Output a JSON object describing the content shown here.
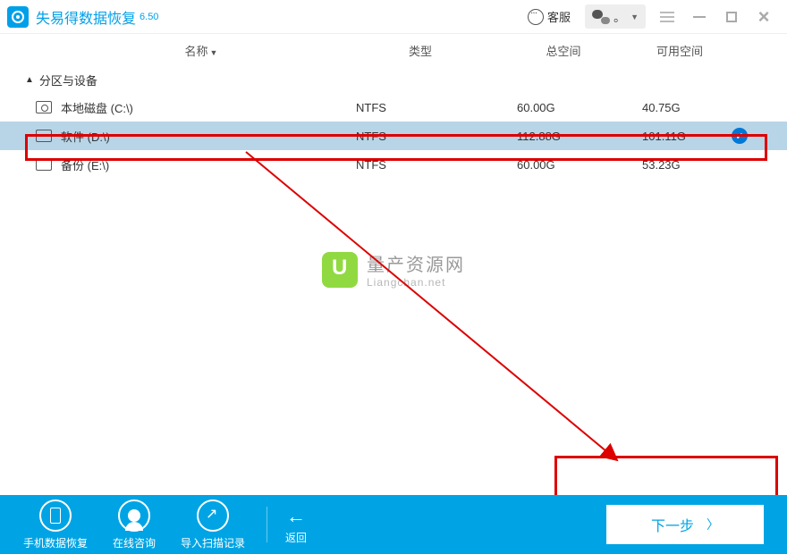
{
  "app": {
    "title": "失易得数据恢复",
    "version": "6.50"
  },
  "titlebar": {
    "kefu": "客服",
    "wechat_dot": "。"
  },
  "columns": {
    "name": "名称",
    "type": "类型",
    "total": "总空间",
    "available": "可用空间"
  },
  "section": {
    "label": "分区与设备"
  },
  "drives": [
    {
      "name": "本地磁盘 (C:\\)",
      "type": "NTFS",
      "total": "60.00G",
      "available": "40.75G",
      "selected": false,
      "icon": "disk"
    },
    {
      "name": "软件 (D:\\)",
      "type": "NTFS",
      "total": "112.88G",
      "available": "101.11G",
      "selected": true,
      "icon": "drive"
    },
    {
      "name": "备份 (E:\\)",
      "type": "NTFS",
      "total": "60.00G",
      "available": "53.23G",
      "selected": false,
      "icon": "drive"
    }
  ],
  "watermark": {
    "title": "量产资源网",
    "sub": "Liangchan.net"
  },
  "footer": {
    "phone": "手机数据恢复",
    "online": "在线咨询",
    "import": "导入扫描记录",
    "back": "返回",
    "next": "下一步"
  }
}
